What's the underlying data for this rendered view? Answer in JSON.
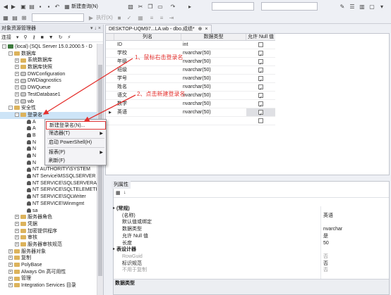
{
  "toolbar": {
    "new_query_label": "新建查询(N)",
    "execute_label": "执行(X)"
  },
  "object_explorer": {
    "title": "对象资源管理器",
    "title_icons": "▾ ↓ ×",
    "connect_label": "连接",
    "tree": [
      {
        "label": "(local) (SQL Server 15.0.2000.5 - D",
        "level": 0,
        "exp": "-",
        "icon": "server"
      },
      {
        "label": "数据库",
        "level": 1,
        "exp": "-",
        "icon": "folder"
      },
      {
        "label": "系统数据库",
        "level": 2,
        "exp": "+",
        "icon": "folder"
      },
      {
        "label": "数据库快照",
        "level": 2,
        "exp": "+",
        "icon": "folder"
      },
      {
        "label": "DWConfiguration",
        "level": 2,
        "exp": "+",
        "icon": "db"
      },
      {
        "label": "DWDiagnostics",
        "level": 2,
        "exp": "+",
        "icon": "db"
      },
      {
        "label": "DWQueue",
        "level": 2,
        "exp": "+",
        "icon": "db"
      },
      {
        "label": "TestDatabase1",
        "level": 2,
        "exp": "+",
        "icon": "db"
      },
      {
        "label": "wb",
        "level": 2,
        "exp": "+",
        "icon": "db"
      },
      {
        "label": "安全性",
        "level": 1,
        "exp": "-",
        "icon": "folder"
      },
      {
        "label": "登录名",
        "level": 2,
        "exp": "-",
        "icon": "folder",
        "selected": true
      },
      {
        "label": "A",
        "level": 3,
        "exp": "",
        "icon": "user"
      },
      {
        "label": "A",
        "level": 3,
        "exp": "",
        "icon": "user"
      },
      {
        "label": "B",
        "level": 3,
        "exp": "",
        "icon": "user"
      },
      {
        "label": "N",
        "level": 3,
        "exp": "",
        "icon": "user"
      },
      {
        "label": "N",
        "level": 3,
        "exp": "",
        "icon": "user"
      },
      {
        "label": "N",
        "level": 3,
        "exp": "",
        "icon": "user"
      },
      {
        "label": "N",
        "level": 3,
        "exp": "",
        "icon": "user"
      },
      {
        "label": "NT AUTHORITY\\SYSTEM",
        "level": 3,
        "exp": "",
        "icon": "user"
      },
      {
        "label": "NT Service\\MSSQLSERVER",
        "level": 3,
        "exp": "",
        "icon": "user"
      },
      {
        "label": "NT SERVICE\\SQLSERVERAG",
        "level": 3,
        "exp": "",
        "icon": "user"
      },
      {
        "label": "NT SERVICE\\SQLTELEMETR",
        "level": 3,
        "exp": "",
        "icon": "user"
      },
      {
        "label": "NT SERVICE\\SQLWriter",
        "level": 3,
        "exp": "",
        "icon": "user"
      },
      {
        "label": "NT SERVICE\\Winmgmt",
        "level": 3,
        "exp": "",
        "icon": "user"
      },
      {
        "label": "sa",
        "level": 3,
        "exp": "",
        "icon": "user"
      },
      {
        "label": "服务器角色",
        "level": 2,
        "exp": "+",
        "icon": "folder"
      },
      {
        "label": "凭据",
        "level": 2,
        "exp": "+",
        "icon": "folder"
      },
      {
        "label": "加密提供程序",
        "level": 2,
        "exp": "+",
        "icon": "folder"
      },
      {
        "label": "审核",
        "level": 2,
        "exp": "+",
        "icon": "folder"
      },
      {
        "label": "服务器审核规范",
        "level": 2,
        "exp": "+",
        "icon": "folder"
      },
      {
        "label": "服务器对象",
        "level": 1,
        "exp": "+",
        "icon": "folder"
      },
      {
        "label": "复制",
        "level": 1,
        "exp": "+",
        "icon": "folder"
      },
      {
        "label": "PolyBase",
        "level": 1,
        "exp": "+",
        "icon": "folder"
      },
      {
        "label": "Always On 高可用性",
        "level": 1,
        "exp": "+",
        "icon": "folder"
      },
      {
        "label": "管理",
        "level": 1,
        "exp": "+",
        "icon": "folder"
      },
      {
        "label": "Integration Services 目录",
        "level": 1,
        "exp": "+",
        "icon": "folder"
      }
    ]
  },
  "context_menu": {
    "items": [
      {
        "label": "新建登录名(N)...",
        "submenu": false,
        "highlight": true
      },
      {
        "label": "筛选器(T)",
        "submenu": true
      },
      {
        "label": "启动 PowerShell(H)",
        "submenu": false
      },
      {
        "label": "报表(P)",
        "submenu": true
      },
      {
        "label": "刷新(F)",
        "submenu": false
      }
    ]
  },
  "document": {
    "tab_label": "DESKTOP-UQM97...LA.wb - dbo.成绩*",
    "columns": [
      "列名",
      "数据类型",
      "允许 Null 值"
    ],
    "rows": [
      {
        "name": "ID",
        "type": "int",
        "nullable": false
      },
      {
        "name": "学校",
        "type": "nvarchar(50)",
        "nullable": true
      },
      {
        "name": "年级",
        "type": "nvarchar(50)",
        "nullable": true
      },
      {
        "name": "班级",
        "type": "nvarchar(50)",
        "nullable": true
      },
      {
        "name": "学号",
        "type": "nvarchar(50)",
        "nullable": true
      },
      {
        "name": "姓名",
        "type": "nvarchar(50)",
        "nullable": true
      },
      {
        "name": "语文",
        "type": "nvarchar(50)",
        "nullable": true
      },
      {
        "name": "数学",
        "type": "nvarchar(50)",
        "nullable": true
      },
      {
        "name": "英语",
        "type": "nvarchar(50)",
        "nullable": true,
        "current": true
      },
      {
        "name": "",
        "type": "",
        "nullable": false
      }
    ]
  },
  "annotations": {
    "step1": "1、鼠标右击登录名",
    "step2": "2、点击新建登录名"
  },
  "properties": {
    "tab_label": "列属性",
    "rows": [
      {
        "key": "(常规)",
        "value": "",
        "section": true
      },
      {
        "key": "(名称)",
        "value": "英语"
      },
      {
        "key": "默认值或绑定",
        "value": ""
      },
      {
        "key": "数据类型",
        "value": "nvarchar"
      },
      {
        "key": "允许 Null 值",
        "value": "是"
      },
      {
        "key": "长度",
        "value": "50"
      },
      {
        "key": "表设计器",
        "value": "",
        "section": true
      },
      {
        "key": "RowGuid",
        "value": "否",
        "dim": true
      },
      {
        "key": "标识规范",
        "value": "否"
      },
      {
        "key": "不用于复制",
        "value": "否",
        "dim": true
      }
    ],
    "description_title": "数据类型"
  },
  "colors": {
    "annotation_red": "#e5312e",
    "selection_blue": "#cde4f7"
  }
}
